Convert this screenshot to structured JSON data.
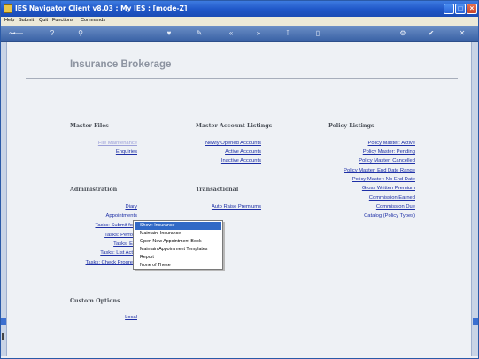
{
  "window": {
    "title": "IES Navigator Client v8.03 : My IES :      [mode-Z]"
  },
  "menu": {
    "items": [
      "Help",
      "Submit",
      "Quit",
      "Functions",
      "Commands"
    ]
  },
  "page": {
    "title": "Insurance Brokerage"
  },
  "sections": {
    "master_files": {
      "heading": "Master Files",
      "links": [
        "File Maintenance",
        "Enquiries"
      ]
    },
    "master_account_listings": {
      "heading": "Master Account Listings",
      "links": [
        "Newly Opened Accounts",
        "Active Accounts",
        "Inactive Accounts"
      ]
    },
    "policy_listings": {
      "heading": "Policy Listings",
      "links": [
        "Policy Master: Active",
        "Policy Master: Pending",
        "Policy Master: Cancelled",
        "Policy Master: End Date Range",
        "Policy Master: No End Date",
        "Gross Written Premium",
        "Commission Earned",
        "Commission Due",
        "Catalog (Policy Types)"
      ]
    },
    "administration": {
      "heading": "Administration",
      "links": [
        "Diary",
        "Appointments",
        "Tasks: Submit fo",
        "Tasks: Perfo",
        "Tasks: E",
        "Tasks: List Act",
        "Tasks: Check Progre"
      ]
    },
    "transactional": {
      "heading": "Transactional",
      "links": [
        "Auto Raise Premiums"
      ]
    },
    "custom_options": {
      "heading": "Custom Options",
      "links": [
        "Local"
      ]
    }
  },
  "context_menu": {
    "items": [
      "Show: Insurance",
      "Maintain: Insurance",
      "Open New Appointment Book",
      "Maintain Appointment Templates",
      "Report",
      "None of These"
    ]
  },
  "colors": {
    "titlebar": "#1f56c7",
    "link": "#1d2fa6",
    "highlight": "#3169c6"
  }
}
